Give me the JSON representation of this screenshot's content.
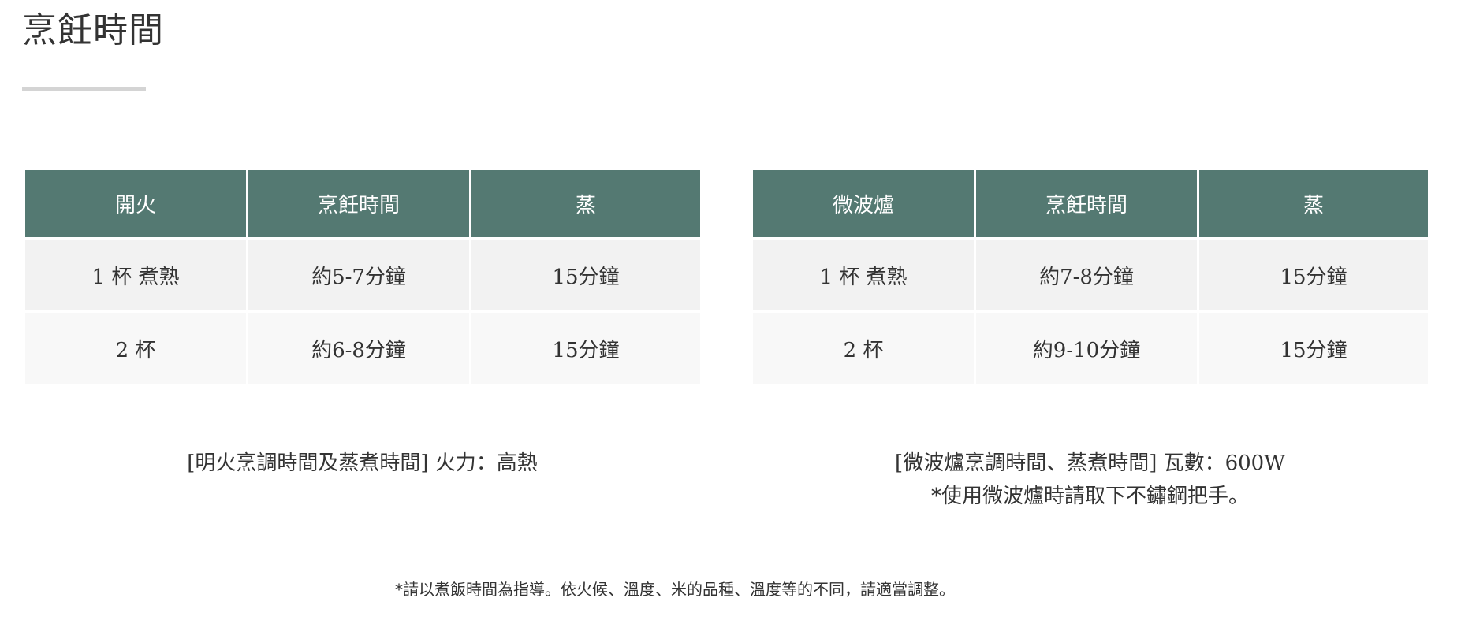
{
  "page": {
    "title": "烹飪時間"
  },
  "stovetop_table": {
    "headers": [
      "開火",
      "烹飪時間",
      "蒸"
    ],
    "rows": [
      [
        "1 杯 煮熟",
        "約5-7分鐘",
        "15分鐘"
      ],
      [
        "2 杯",
        "約6-8分鐘",
        "15分鐘"
      ]
    ],
    "note": "[明火烹調時間及蒸煮時間] 火力：高熱"
  },
  "microwave_table": {
    "headers": [
      "微波爐",
      "烹飪時間",
      "蒸"
    ],
    "rows": [
      [
        "1 杯 煮熟",
        "約7-8分鐘",
        "15分鐘"
      ],
      [
        "2 杯",
        "約9-10分鐘",
        "15分鐘"
      ]
    ],
    "note_line1": "[微波爐烹調時間、蒸煮時間] 瓦數：600W",
    "note_line2": "*使用微波爐時請取下不鏽鋼把手。"
  },
  "footnote": "*請以煮飯時間為指導。依火候、溫度、米的品種、溫度等的不同，請適當調整。",
  "colors": {
    "header_bg": "#547972",
    "row_odd_bg": "#f2f2f2",
    "row_even_bg": "#f8f8f8",
    "text": "#333333",
    "underline": "#d4d4d4"
  }
}
